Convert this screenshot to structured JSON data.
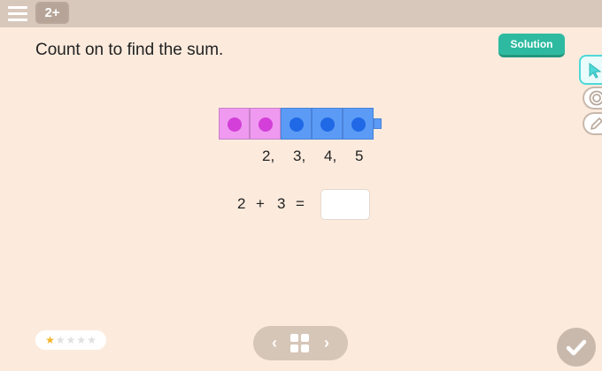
{
  "header": {
    "grade_label": "2+"
  },
  "question": {
    "text": "Count on to find the sum.",
    "solution_label": "Solution"
  },
  "count_sequence": [
    "2,",
    "3,",
    "4,",
    "5"
  ],
  "equation": {
    "a": "2",
    "plus": "+",
    "b": "3",
    "equals": "="
  },
  "answer": {
    "value": ""
  },
  "rating": {
    "stars_filled": 1,
    "stars_total": 5,
    "star_glyph": "★"
  },
  "colors": {
    "pink_cube": "#ef99f0",
    "blue_cube": "#5b9bf5",
    "accent": "#2ebaa0"
  },
  "nav": {
    "prev_glyph": "‹",
    "next_glyph": "›"
  }
}
